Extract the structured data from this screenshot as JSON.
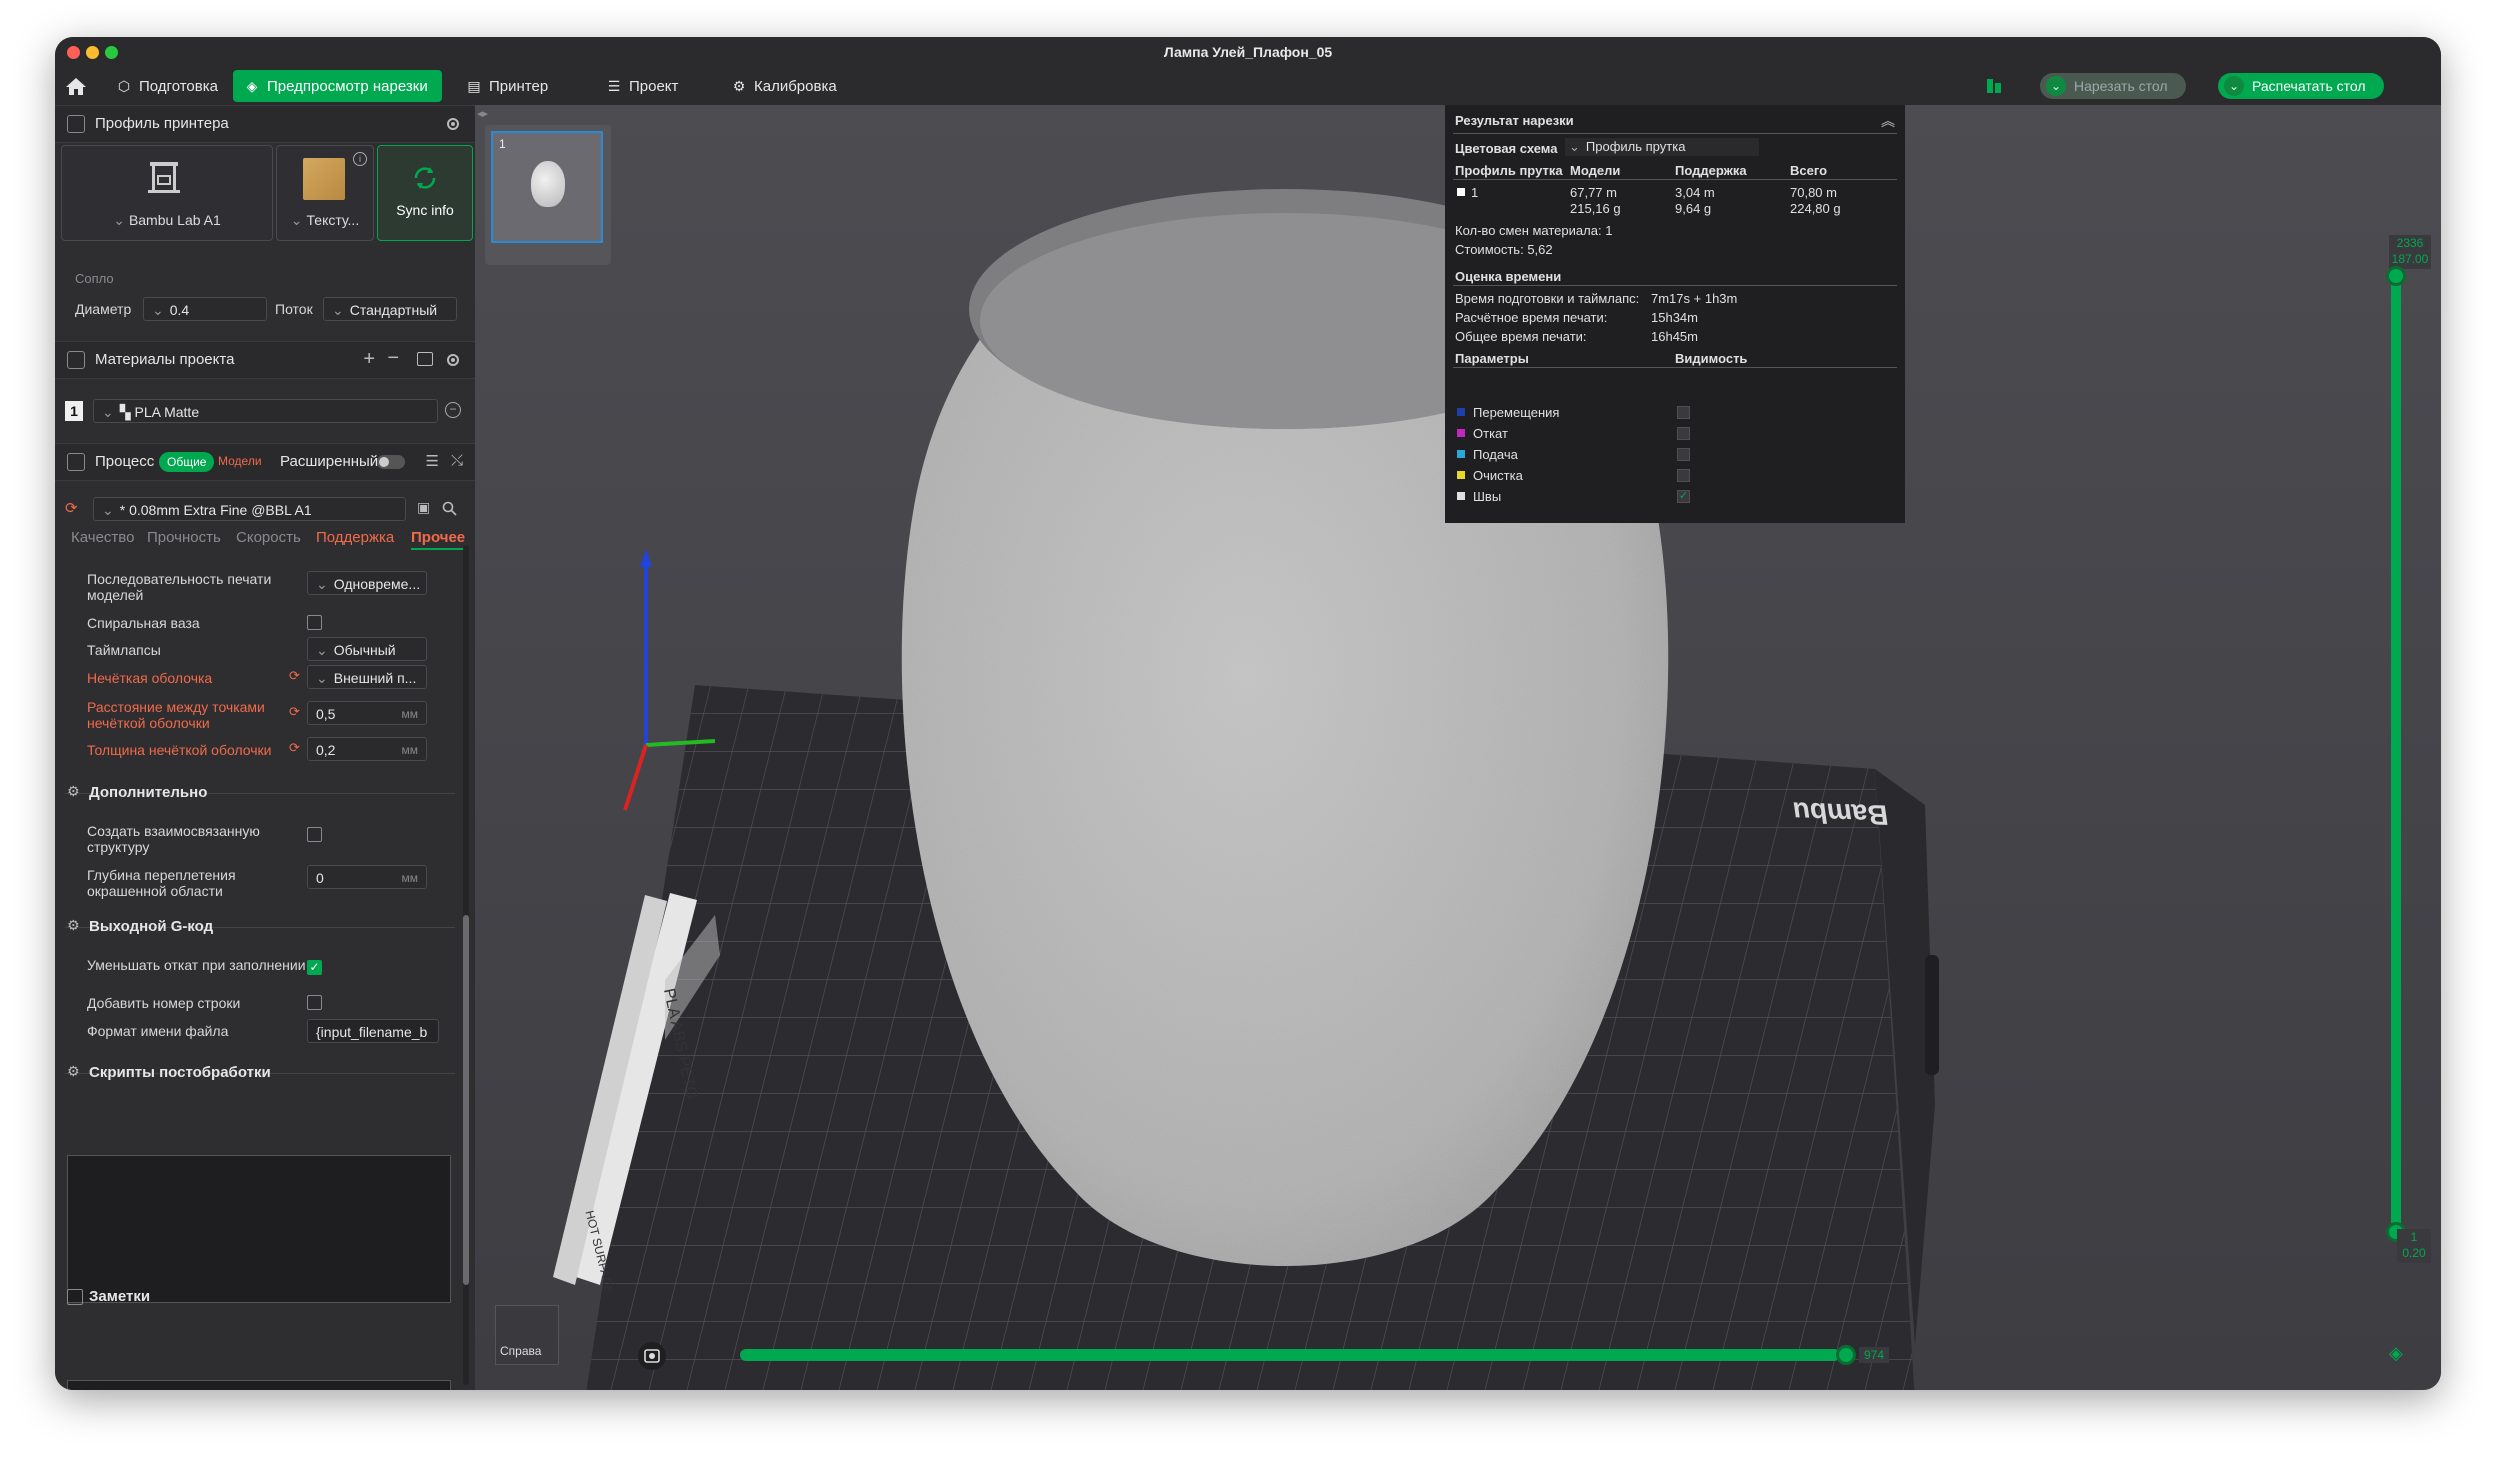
{
  "window": {
    "title": "Лампа Улей_Плафон_05"
  },
  "toolbar": {
    "tabs": [
      {
        "label": "Подготовка"
      },
      {
        "label": "Предпросмотр нарезки"
      },
      {
        "label": "Принтер"
      },
      {
        "label": "Проект"
      },
      {
        "label": "Калибровка"
      }
    ],
    "slice_button": "Нарезать стол",
    "print_button": "Распечатать стол"
  },
  "printer_profile": {
    "header": "Профиль принтера",
    "printer_name": "Bambu Lab A1",
    "plate_type": "Тексту...",
    "sync_label": "Sync info",
    "nozzle_label": "Сопло",
    "diameter_label": "Диаметр",
    "diameter_value": "0.4",
    "flow_label": "Поток",
    "flow_value": "Стандартный"
  },
  "materials": {
    "header": "Материалы проекта",
    "slot_number": "1",
    "material_name": "PLA Matte"
  },
  "process": {
    "header": "Процесс",
    "toggle_global": "Общие",
    "toggle_models": "Модели",
    "advanced_label": "Расширенный",
    "preset": "* 0.08mm Extra Fine @BBL A1",
    "tabs": [
      {
        "label": "Качество"
      },
      {
        "label": "Прочность"
      },
      {
        "label": "Скорость"
      },
      {
        "label": "Поддержка"
      },
      {
        "label": "Прочее"
      }
    ]
  },
  "params": {
    "print_sequence_label": "Последовательность печати моделей",
    "print_sequence_value": "Одновреме...",
    "spiral_vase_label": "Спиральная ваза",
    "timelapse_label": "Таймлапсы",
    "timelapse_value": "Обычный",
    "fuzzy_skin_label": "Нечёткая оболочка",
    "fuzzy_skin_value": "Внешний п...",
    "fuzzy_distance_label": "Расстояние между точками нечёткой оболочки",
    "fuzzy_distance_value": "0,5",
    "fuzzy_thickness_label": "Толщина нечёткой оболочки",
    "fuzzy_thickness_value": "0,2",
    "unit_mm": "мм",
    "extra_header": "Дополнительно",
    "interlock_label": "Создать взаимосвязанную структуру",
    "interlock_depth_label": "Глубина переплетения окрашенной области",
    "interlock_depth_value": "0",
    "gcode_header": "Выходной G-код",
    "reduce_retract_label": "Уменьшать откат при заполнении",
    "line_number_label": "Добавить номер строки",
    "filename_format_label": "Формат имени файла",
    "filename_format_value": "{input_filename_b",
    "post_scripts_header": "Скрипты постобработки",
    "notes_header": "Заметки"
  },
  "viewport": {
    "plate_thumb_number": "1",
    "bed_brand": "Bambu",
    "bed_label_1": "PLA ABS PETG",
    "bed_label_2": "HOT SURFACE",
    "view_label": "Справа",
    "layer_top_value": "2336",
    "layer_top_height": "187.00",
    "layer_bottom_value": "1",
    "layer_bottom_height": "0.20",
    "move_slider_value": "974"
  },
  "results": {
    "header": "Результат нарезки",
    "color_scheme_label": "Цветовая схема",
    "color_scheme_value": "Профиль прутка",
    "col_filament": "Профиль прутка",
    "col_models": "Модели",
    "col_support": "Поддержка",
    "col_total": "Всего",
    "row_id": "1",
    "models_length": "67,77 m",
    "models_weight": "215,16 g",
    "support_length": "3,04 m",
    "support_weight": "9,64 g",
    "total_length": "70,80 m",
    "total_weight": "224,80 g",
    "material_changes_label": "Кол-во смен материала:",
    "material_changes_value": "1",
    "cost_label": "Стоимость:",
    "cost_value": "5,62",
    "time_header": "Оценка времени",
    "prep_time_label": "Время подготовки и таймлапс:",
    "prep_time_value": "7m17s + 1h3m",
    "calc_time_label": "Расчётное время печати:",
    "calc_time_value": "15h34m",
    "total_time_label": "Общее время печати:",
    "total_time_value": "16h45m",
    "params_header": "Параметры",
    "visibility_header": "Видимость",
    "legend": [
      {
        "label": "Перемещения",
        "color": "#1f3fae"
      },
      {
        "label": "Откат",
        "color": "#c028c0"
      },
      {
        "label": "Подача",
        "color": "#2aa8d8"
      },
      {
        "label": "Очистка",
        "color": "#e8d82a"
      },
      {
        "label": "Швы",
        "color": "#e0e0e0"
      }
    ]
  },
  "colors": {
    "accent": "#00a84f",
    "modified": "#f06a4a",
    "panel": "#2e2e31",
    "viewport": "#45454a"
  }
}
